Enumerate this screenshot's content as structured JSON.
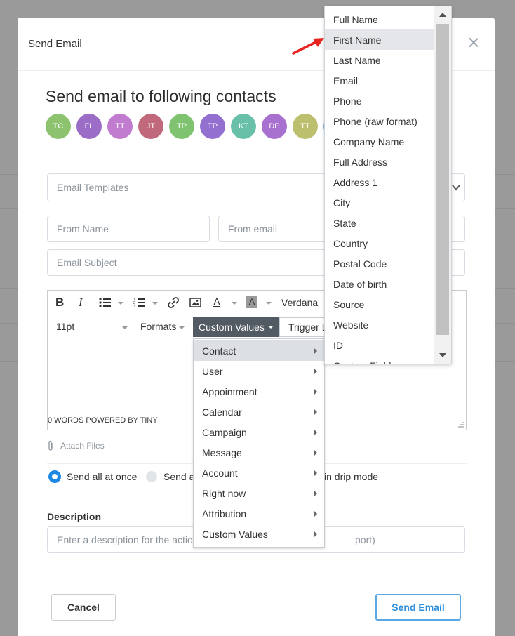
{
  "modal": {
    "title": "Send Email",
    "heading": "Send email to following contacts"
  },
  "avatars": [
    {
      "initials": "TC",
      "color": "#8dc26f"
    },
    {
      "initials": "FL",
      "color": "#9b6dc6"
    },
    {
      "initials": "TT",
      "color": "#c27ccf"
    },
    {
      "initials": "JT",
      "color": "#c0697c"
    },
    {
      "initials": "TP",
      "color": "#7fc370"
    },
    {
      "initials": "TP",
      "color": "#9370cf"
    },
    {
      "initials": "KT",
      "color": "#68c0a9"
    },
    {
      "initials": "DP",
      "color": "#a870cf"
    },
    {
      "initials": "TT",
      "color": "#bcbf6e"
    }
  ],
  "form": {
    "templates_placeholder": "Email Templates",
    "from_name_placeholder": "From Name",
    "from_email_placeholder": "From email",
    "subject_placeholder": "Email Subject",
    "description_label": "Description",
    "description_placeholder": "Enter a description for the actio",
    "description_tail": "port)"
  },
  "editor": {
    "font_family": "Verdana",
    "font_size": "11pt",
    "formats_label": "Formats",
    "custom_values_label": "Custom Values",
    "trigger_label": "Trigger L",
    "status": "0 WORDS POWERED BY TINY"
  },
  "attach_label": "Attach Files",
  "send_options": {
    "all_at_once": "Send all at once",
    "send_a": "Send a",
    "drip_mode": "in drip mode"
  },
  "buttons": {
    "cancel": "Cancel",
    "send": "Send Email"
  },
  "custom_values_menu": [
    {
      "label": "Contact",
      "active": true
    },
    {
      "label": "User"
    },
    {
      "label": "Appointment"
    },
    {
      "label": "Calendar"
    },
    {
      "label": "Campaign"
    },
    {
      "label": "Message"
    },
    {
      "label": "Account"
    },
    {
      "label": "Right now"
    },
    {
      "label": "Attribution"
    },
    {
      "label": "Custom Values"
    }
  ],
  "contact_submenu": [
    "Full Name",
    "First Name",
    "Last Name",
    "Email",
    "Phone",
    "Phone (raw format)",
    "Company Name",
    "Full Address",
    "Address 1",
    "City",
    "State",
    "Country",
    "Postal Code",
    "Date of birth",
    "Source",
    "Website",
    "ID",
    "Custom Fields"
  ],
  "contact_submenu_active": "First Name",
  "accent_color": "#1e88e5"
}
